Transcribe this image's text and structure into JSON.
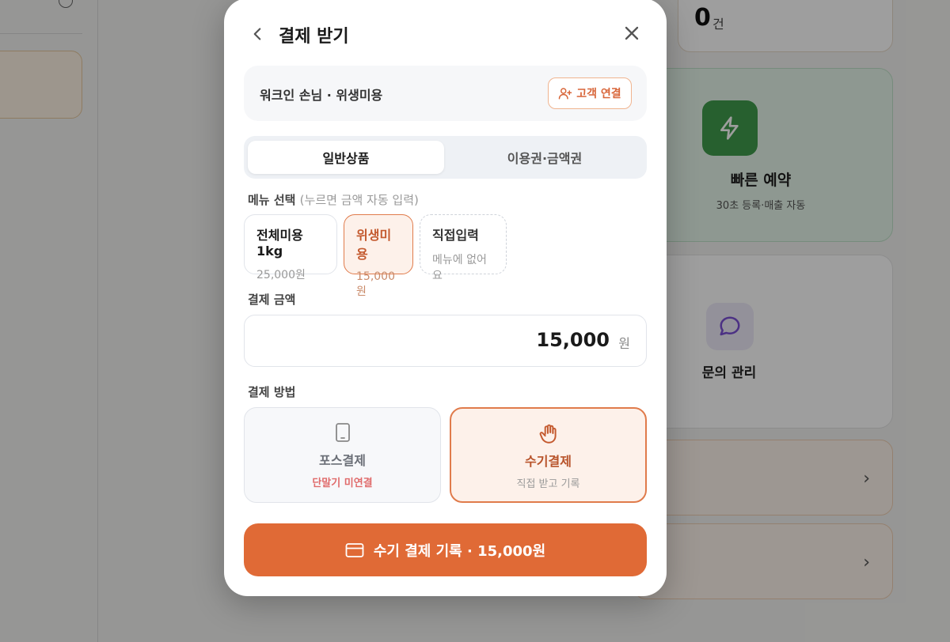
{
  "background": {
    "count": {
      "value": "0",
      "unit": "건"
    },
    "quick_reserve": {
      "title": "빠른 예약",
      "subtitle": "30초 등록·매출 자동"
    },
    "inquiry": {
      "title": "문의 관리"
    }
  },
  "modal": {
    "title": "결제 받기",
    "customer": {
      "label": "워크인 손님 · 위생미용",
      "connect_button": "고객 연결"
    },
    "tabs": [
      {
        "label": "일반상품",
        "active": true
      },
      {
        "label": "이용권·금액권",
        "active": false
      }
    ],
    "menu_section": {
      "label": "메뉴 선택",
      "hint": "(누르면 금액 자동 입력)"
    },
    "menu_items": [
      {
        "name": "전체미용 1kg",
        "price": "25,000원",
        "selected": false
      },
      {
        "name": "위생미용",
        "price": "15,000원",
        "selected": true
      },
      {
        "name": "직접입력",
        "price": "메뉴에 없어요",
        "selected": false
      }
    ],
    "amount_section": {
      "label": "결제 금액",
      "value": "15,000",
      "unit": "원"
    },
    "method_section": {
      "label": "결제 방법"
    },
    "methods": [
      {
        "title": "포스결제",
        "subtitle": "단말기 미연결",
        "icon": "tablet-icon",
        "selected": false
      },
      {
        "title": "수기결제",
        "subtitle": "직접 받고 기록",
        "icon": "hand-icon",
        "selected": true
      }
    ],
    "submit_label": "수기 결제 기록 · 15,000원"
  },
  "colors": {
    "accent": "#e06a36",
    "accent_light": "#fdf1ea",
    "warning": "#e06b6b"
  }
}
